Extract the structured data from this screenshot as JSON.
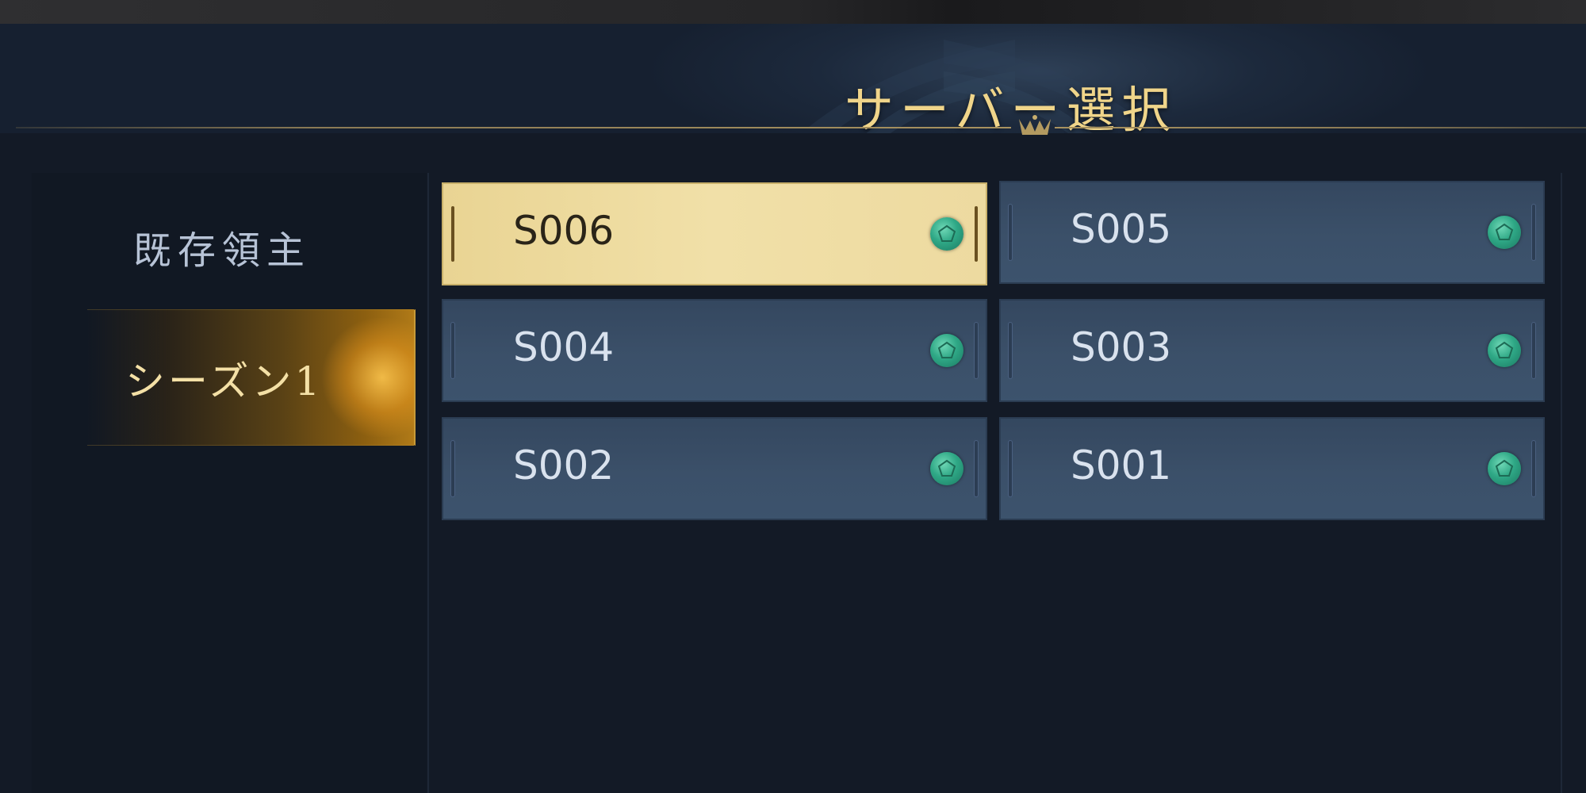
{
  "header": {
    "title": "サーバー選択"
  },
  "sidebar": {
    "items": [
      {
        "label": "既存領主",
        "selected": false
      },
      {
        "label": "シーズン1",
        "selected": true
      }
    ]
  },
  "servers": [
    {
      "name": "S006",
      "selected": true,
      "status_icon": "server-status-icon"
    },
    {
      "name": "S005",
      "selected": false,
      "status_icon": "server-status-icon"
    },
    {
      "name": "S004",
      "selected": false,
      "status_icon": "server-status-icon"
    },
    {
      "name": "S003",
      "selected": false,
      "status_icon": "server-status-icon"
    },
    {
      "name": "S002",
      "selected": false,
      "status_icon": "server-status-icon"
    },
    {
      "name": "S001",
      "selected": false,
      "status_icon": "server-status-icon"
    }
  ],
  "colors": {
    "title_gold": "#f0d58a",
    "selected_card": "#e9d493",
    "card_blue": "#3b5069",
    "status_green": "#2fa886",
    "background": "#131a26"
  }
}
